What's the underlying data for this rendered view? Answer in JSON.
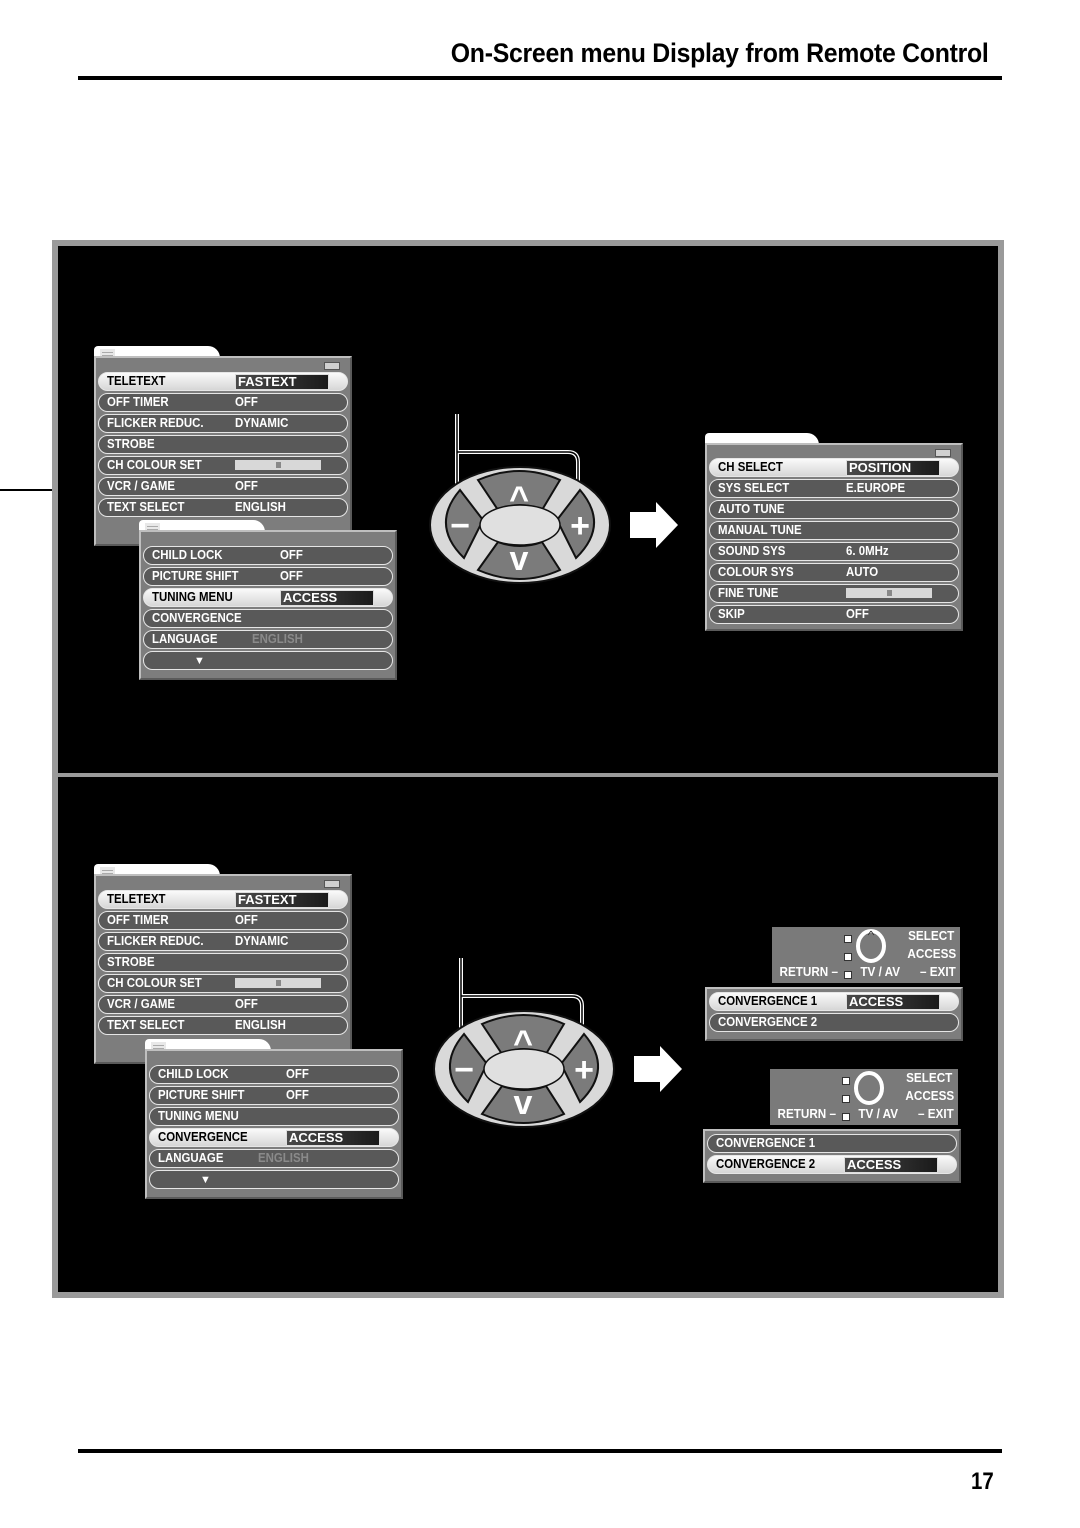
{
  "page": {
    "title": "On-Screen menu Display from Remote Control",
    "page_number": "17"
  },
  "panel1": {
    "setup_menu": {
      "rows": [
        {
          "label": "TELETEXT",
          "value": "FASTEXT",
          "selected": true
        },
        {
          "label": "OFF TIMER",
          "value": "OFF"
        },
        {
          "label": "FLICKER REDUC.",
          "value": "DYNAMIC"
        },
        {
          "label": "STROBE",
          "value": ""
        },
        {
          "label": "CH COLOUR SET",
          "value": "",
          "slider": 0.5
        },
        {
          "label": "VCR / GAME",
          "value": "OFF"
        },
        {
          "label": "TEXT SELECT",
          "value": "ENGLISH"
        }
      ]
    },
    "sub_menu": {
      "rows": [
        {
          "label": "CHILD LOCK",
          "value": "OFF"
        },
        {
          "label": "PICTURE SHIFT",
          "value": "OFF"
        },
        {
          "label": "TUNING MENU",
          "value": "ACCESS",
          "selected": true
        },
        {
          "label": "CONVERGENCE",
          "value": ""
        },
        {
          "label": "LANGUAGE",
          "value": "ENGLISH",
          "dimmed": true
        }
      ],
      "more_indicator": "▼"
    },
    "remote": {
      "up": "^",
      "down": "v",
      "minus": "−",
      "plus": "+"
    },
    "tuning_menu": {
      "rows": [
        {
          "label": "CH SELECT",
          "value": "POSITION",
          "selected": true
        },
        {
          "label": "SYS SELECT",
          "value": "E.EUROPE"
        },
        {
          "label": "AUTO TUNE",
          "value": ""
        },
        {
          "label": "MANUAL TUNE",
          "value": ""
        },
        {
          "label": "SOUND SYS",
          "value": "6. 0MHz"
        },
        {
          "label": "COLOUR SYS",
          "value": "AUTO"
        },
        {
          "label": "FINE TUNE",
          "value": "",
          "slider": 0.5
        },
        {
          "label": "SKIP",
          "value": "OFF"
        }
      ]
    }
  },
  "panel2": {
    "setup_menu": {
      "rows": [
        {
          "label": "TELETEXT",
          "value": "FASTEXT",
          "selected": true
        },
        {
          "label": "OFF TIMER",
          "value": "OFF"
        },
        {
          "label": "FLICKER REDUC.",
          "value": "DYNAMIC"
        },
        {
          "label": "STROBE",
          "value": ""
        },
        {
          "label": "CH COLOUR SET",
          "value": "",
          "slider": 0.5
        },
        {
          "label": "VCR / GAME",
          "value": "OFF"
        },
        {
          "label": "TEXT SELECT",
          "value": "ENGLISH"
        }
      ]
    },
    "sub_menu": {
      "rows": [
        {
          "label": "CHILD LOCK",
          "value": "OFF"
        },
        {
          "label": "PICTURE SHIFT",
          "value": "OFF"
        },
        {
          "label": "TUNING MENU",
          "value": ""
        },
        {
          "label": "CONVERGENCE",
          "value": "ACCESS",
          "selected": true
        },
        {
          "label": "LANGUAGE",
          "value": "ENGLISH",
          "dimmed": true
        }
      ],
      "more_indicator": "▼"
    },
    "remote": {
      "up": "^",
      "down": "v",
      "minus": "−",
      "plus": "+"
    },
    "help": {
      "select": "SELECT",
      "access": "ACCESS",
      "return": "RETURN –",
      "tv_av": "TV / AV",
      "exit": "– EXIT"
    },
    "convergence_menu_1": {
      "rows": [
        {
          "label": "CONVERGENCE 1",
          "value": "ACCESS",
          "selected": true
        },
        {
          "label": "CONVERGENCE 2",
          "value": ""
        }
      ]
    },
    "convergence_menu_2": {
      "rows": [
        {
          "label": "CONVERGENCE 1",
          "value": ""
        },
        {
          "label": "CONVERGENCE 2",
          "value": "ACCESS",
          "selected": true
        }
      ]
    }
  }
}
